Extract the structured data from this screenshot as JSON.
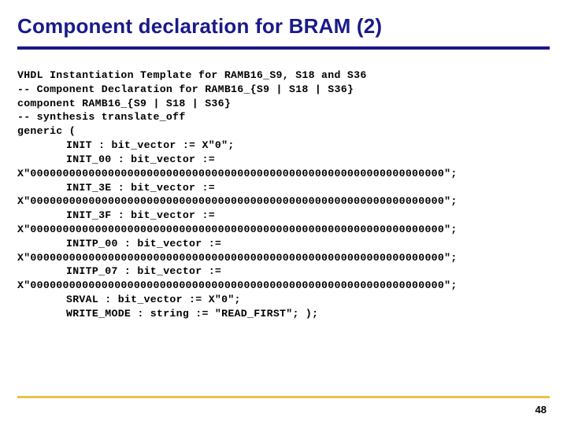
{
  "title": "Component declaration for BRAM (2)",
  "code": {
    "line1": "VHDL Instantiation Template for RAMB16_S9, S18 and S36",
    "line2": "-- Component Declaration for RAMB16_{S9 | S18 | S36}",
    "line3": "component RAMB16_{S9 | S18 | S36}",
    "line4": "-- synthesis translate_off",
    "line5": "generic (",
    "line6": "INIT : bit_vector := X\"0\";",
    "line7": "INIT_00 : bit_vector :=",
    "line8": "X\"0000000000000000000000000000000000000000000000000000000000000000\";",
    "line9": "INIT_3E : bit_vector :=",
    "line10": "X\"0000000000000000000000000000000000000000000000000000000000000000\";",
    "line11": "INIT_3F : bit_vector :=",
    "line12": "X\"0000000000000000000000000000000000000000000000000000000000000000\";",
    "line13": "INITP_00 : bit_vector :=",
    "line14": "X\"0000000000000000000000000000000000000000000000000000000000000000\";",
    "line15": "INITP_07 : bit_vector :=",
    "line16": "X\"0000000000000000000000000000000000000000000000000000000000000000\";",
    "line17": "SRVAL : bit_vector := X\"0\";",
    "line18": "WRITE_MODE : string := \"READ_FIRST\"; );"
  },
  "pageNumber": "48"
}
